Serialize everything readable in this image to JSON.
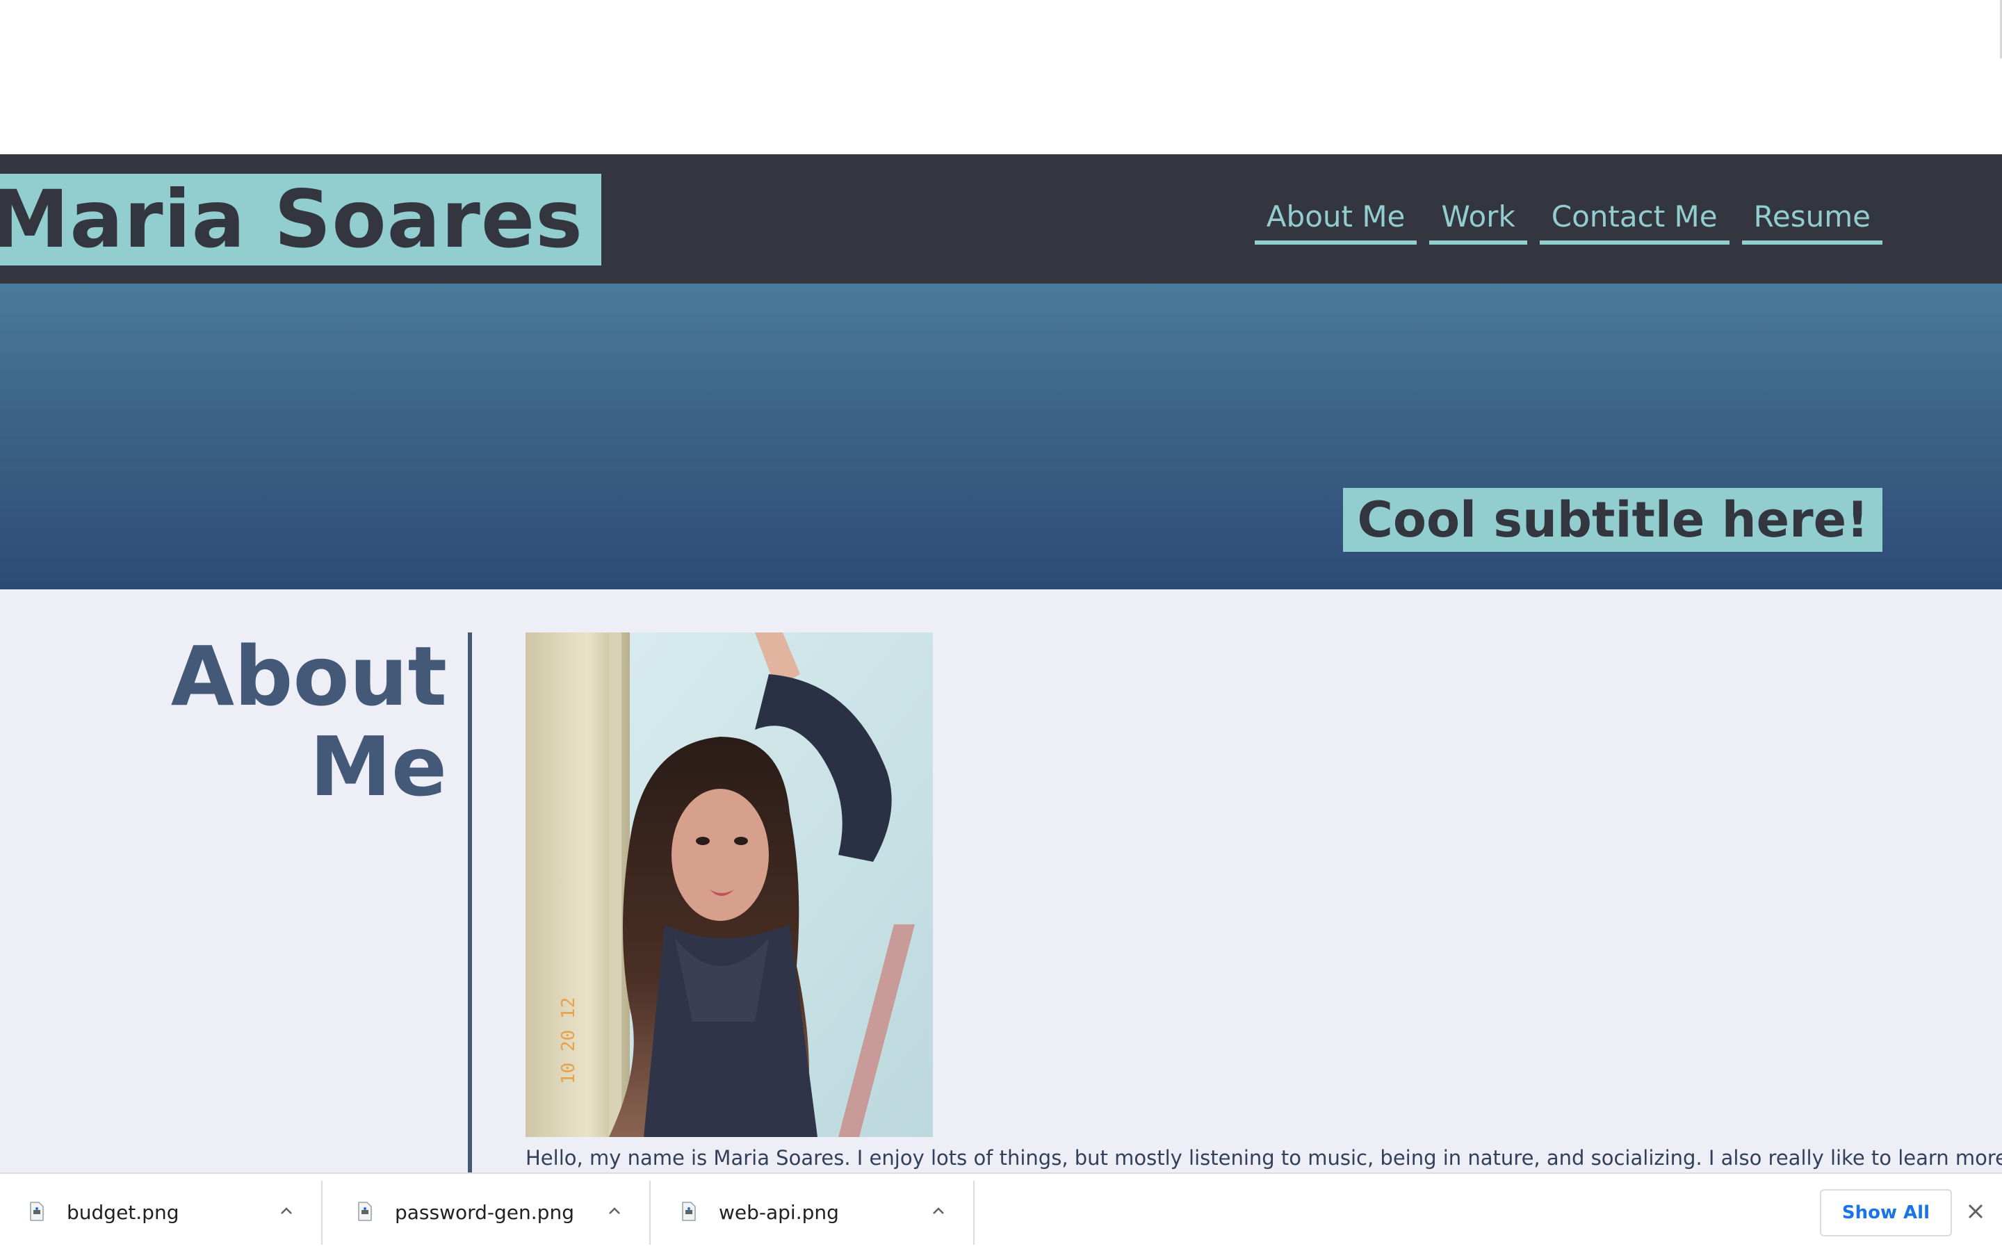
{
  "header": {
    "site_title": "Maria Soares",
    "nav": [
      {
        "label": "About Me"
      },
      {
        "label": "Work"
      },
      {
        "label": "Contact Me"
      },
      {
        "label": "Resume"
      }
    ]
  },
  "hero": {
    "subtitle": "Cool subtitle here!"
  },
  "about": {
    "heading_line1": "About",
    "heading_line2": "Me",
    "text": "Hello, my name is Maria Soares. I enjoy lots of things, but mostly listening to music, being in nature, and socializing. I also really like to learn more"
  },
  "downloads": {
    "items": [
      {
        "name": "budget.png"
      },
      {
        "name": "password-gen.png"
      },
      {
        "name": "web-api.png"
      }
    ],
    "show_all_label": "Show All"
  },
  "colors": {
    "header_bg": "#33353f",
    "accent": "#92cdcf",
    "heading": "#445878",
    "content_bg": "#eeeef7",
    "link_blue": "#1a73e8"
  },
  "icons": {
    "file": "file-icon",
    "chevron": "chevron-up-icon",
    "close": "close-icon"
  }
}
